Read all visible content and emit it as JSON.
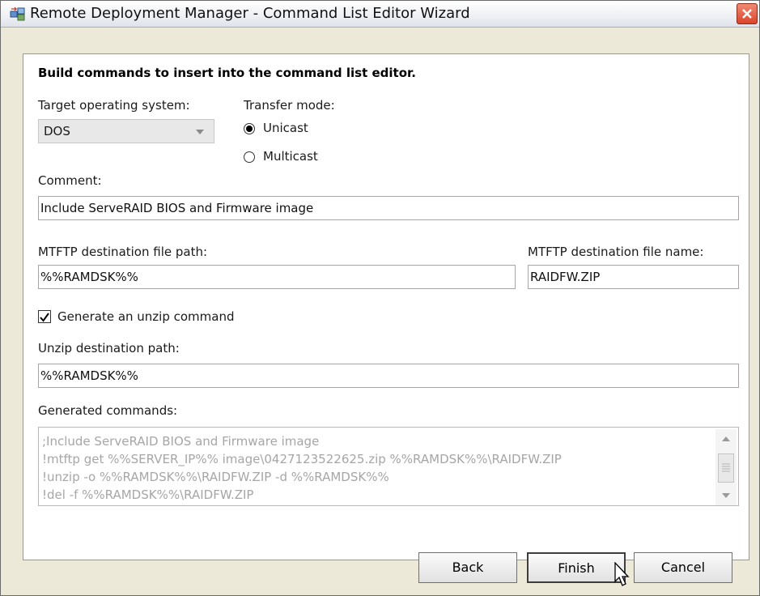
{
  "window": {
    "title": "Remote Deployment Manager - Command List Editor Wizard"
  },
  "icons": [
    "app-icon",
    "close-icon",
    "chevron-down-icon",
    "scroll-up-icon",
    "scroll-down-icon",
    "mouse-pointer-icon"
  ],
  "heading": "Build commands to insert into the command list editor.",
  "target_os": {
    "label": "Target operating system:",
    "value": "DOS"
  },
  "transfer_mode": {
    "label": "Transfer mode:",
    "options": [
      "Unicast",
      "Multicast"
    ],
    "selected": "Unicast"
  },
  "comment": {
    "label": "Comment:",
    "value": "Include ServeRAID BIOS and Firmware image"
  },
  "mtftp_path": {
    "label": "MTFTP destination file path:",
    "value": "%%RAMDSK%%"
  },
  "mtftp_name": {
    "label": "MTFTP destination file name:",
    "value": "RAIDFW.ZIP"
  },
  "unzip": {
    "checkbox_label": "Generate an unzip command",
    "checked": true,
    "path_label": "Unzip destination path:",
    "path_value": "%%RAMDSK%%"
  },
  "generated": {
    "label": "Generated commands:",
    "lines": [
      ";Include ServeRAID BIOS and Firmware image",
      "!mtftp get %%SERVER_IP%% image\\0427123522625.zip %%RAMDSK%%\\RAIDFW.ZIP",
      "!unzip -o %%RAMDSK%%\\RAIDFW.ZIP -d %%RAMDSK%%",
      "!del -f %%RAMDSK%%\\RAIDFW.ZIP"
    ]
  },
  "buttons": {
    "back": "Back",
    "finish": "Finish",
    "cancel": "Cancel"
  }
}
